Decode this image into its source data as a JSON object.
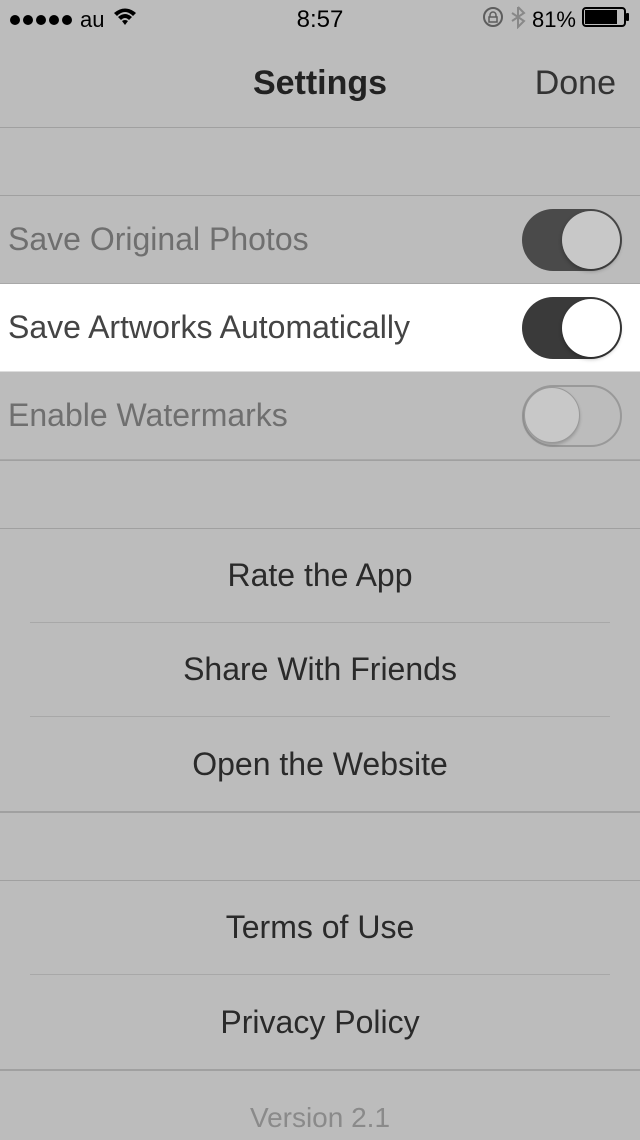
{
  "status": {
    "carrier": "au",
    "time": "8:57",
    "battery_pct": "81%"
  },
  "nav": {
    "title": "Settings",
    "done": "Done"
  },
  "toggles": {
    "save_original": {
      "label": "Save Original Photos",
      "on": true
    },
    "save_artworks": {
      "label": "Save Artworks Automatically",
      "on": true
    },
    "enable_watermarks": {
      "label": "Enable Watermarks",
      "on": false
    }
  },
  "actions1": {
    "rate": "Rate the App",
    "share": "Share With Friends",
    "website": "Open the Website"
  },
  "actions2": {
    "terms": "Terms of Use",
    "privacy": "Privacy Policy"
  },
  "footer": {
    "version": "Version 2.1"
  }
}
